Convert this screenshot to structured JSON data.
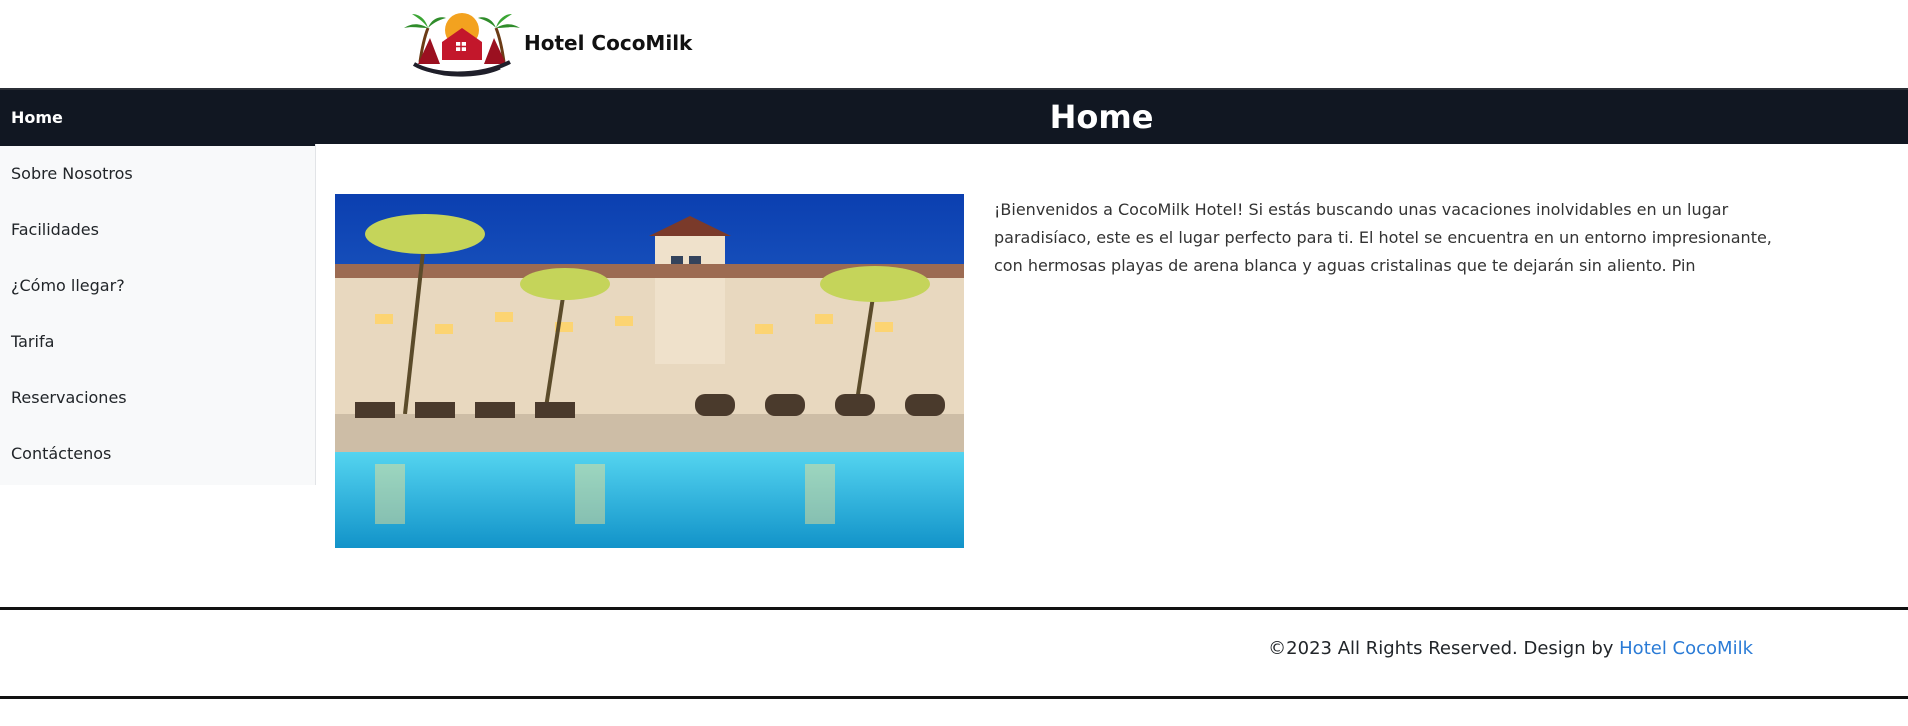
{
  "header": {
    "brand": "Hotel CocoMilk",
    "logo": "hotel-logo-icon"
  },
  "sidebar": {
    "items": [
      {
        "label": "Home",
        "active": true
      },
      {
        "label": "Sobre Nosotros",
        "active": false
      },
      {
        "label": "Facilidades",
        "active": false
      },
      {
        "label": "¿Cómo llegar?",
        "active": false
      },
      {
        "label": "Tarifa",
        "active": false
      },
      {
        "label": "Reservaciones",
        "active": false
      },
      {
        "label": "Contáctenos",
        "active": false
      }
    ]
  },
  "main": {
    "title": "Home",
    "intro": "¡Bienvenidos a CocoMilk Hotel! Si estás buscando unas vacaciones inolvidables en un lugar paradisíaco, este es el lugar perfecto para ti. El hotel se encuentra en un entorno impresionante, con hermosas playas de arena blanca y aguas cristalinas que te dejarán sin aliento. Pin"
  },
  "footer": {
    "prefix": "©2023 All Rights Reserved. Design by ",
    "link_label": "Hotel CocoMilk",
    "link_color": "#2a7bd6"
  },
  "colors": {
    "dark_band": "#111722",
    "sidebar_bg": "#f8f9fa"
  }
}
